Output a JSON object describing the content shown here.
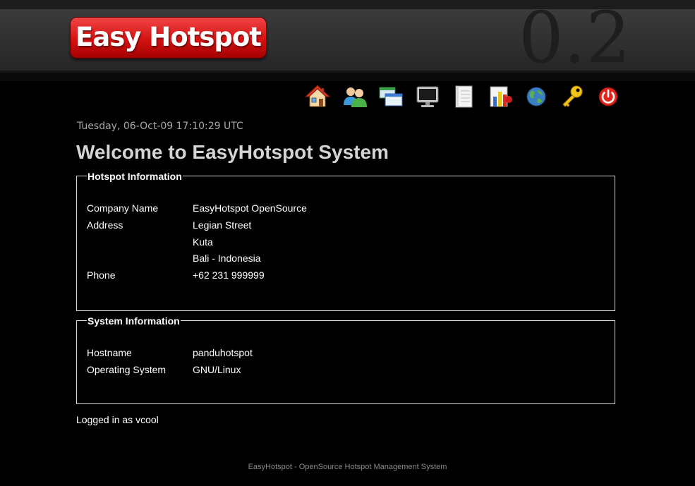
{
  "header": {
    "logo_text": "Easy Hotspot",
    "version": "0.2"
  },
  "toolbar": {
    "items": [
      {
        "icon": "home-icon"
      },
      {
        "icon": "users-icon"
      },
      {
        "icon": "windows-icon"
      },
      {
        "icon": "monitor-icon"
      },
      {
        "icon": "notepad-icon"
      },
      {
        "icon": "report-icon"
      },
      {
        "icon": "globe-icon"
      },
      {
        "icon": "key-icon"
      },
      {
        "icon": "power-icon"
      }
    ]
  },
  "main": {
    "datetime": "Tuesday, 06-Oct-09 17:10:29 UTC",
    "title": "Welcome to EasyHotspot System",
    "hotspot_info": {
      "legend": "Hotspot Information",
      "company_label": "Company Name",
      "company_value": "EasyHotspot OpenSource",
      "address_label": "Address",
      "address_line1": "Legian Street",
      "address_line2": "Kuta",
      "address_line3": "Bali - Indonesia",
      "phone_label": "Phone",
      "phone_value": "+62 231 999999"
    },
    "system_info": {
      "legend": "System Information",
      "hostname_label": "Hostname",
      "hostname_value": "panduhotspot",
      "os_label": "Operating System",
      "os_value": "GNU/Linux"
    },
    "logged_in": "Logged in as vcool"
  },
  "footer": {
    "text": "EasyHotspot - OpenSource Hotspot Management System"
  },
  "colors": {
    "background": "#000000",
    "header": "#333333",
    "logo_red": "#d41212",
    "title_text": "#d4d4d4",
    "datetime_text": "#a8a8a8"
  }
}
